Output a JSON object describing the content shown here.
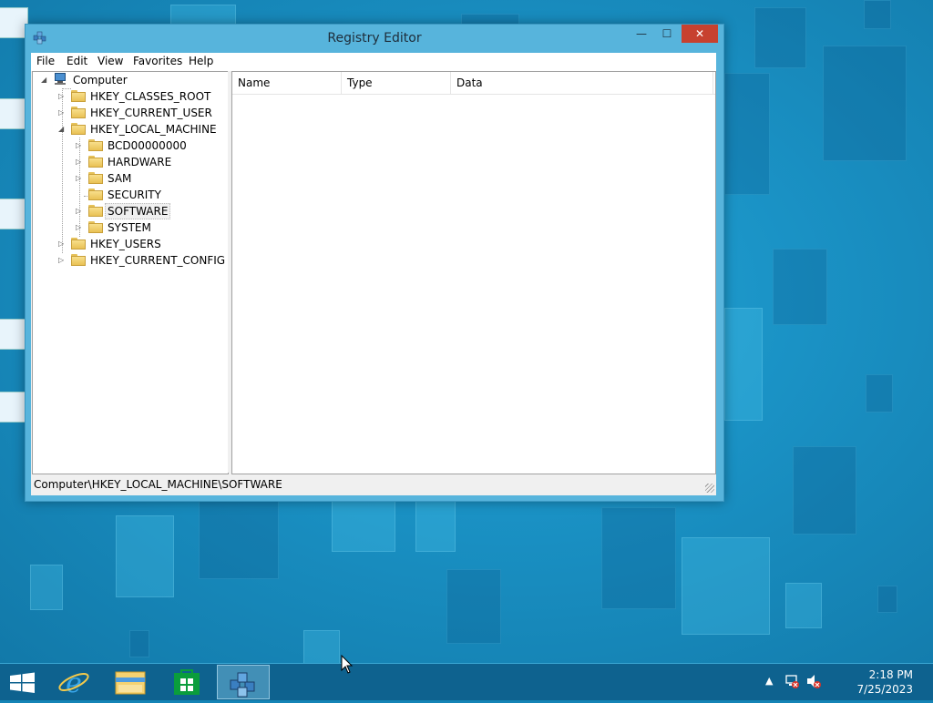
{
  "window": {
    "title": "Registry Editor",
    "buttons": {
      "minimize": "—",
      "maximize": "☐",
      "close": "✕"
    }
  },
  "menu": [
    "File",
    "Edit",
    "View",
    "Favorites",
    "Help"
  ],
  "tree": {
    "root": "Computer",
    "hives": [
      {
        "label": "HKEY_CLASSES_ROOT",
        "expand": "▷"
      },
      {
        "label": "HKEY_CURRENT_USER",
        "expand": "▷"
      },
      {
        "label": "HKEY_LOCAL_MACHINE",
        "expand": "◢"
      },
      {
        "label": "HKEY_USERS",
        "expand": "▷"
      },
      {
        "label": "HKEY_CURRENT_CONFIG",
        "expand": "▷"
      }
    ],
    "hklm_children": [
      {
        "label": "BCD00000000",
        "expand": "▷"
      },
      {
        "label": "HARDWARE",
        "expand": "▷"
      },
      {
        "label": "SAM",
        "expand": "▷"
      },
      {
        "label": "SECURITY",
        "expand": ""
      },
      {
        "label": "SOFTWARE",
        "expand": "▷",
        "selected": true
      },
      {
        "label": "SYSTEM",
        "expand": "▷"
      }
    ]
  },
  "list": {
    "columns": [
      "Name",
      "Type",
      "Data"
    ]
  },
  "status": {
    "path": "Computer\\HKEY_LOCAL_MACHINE\\SOFTWARE"
  },
  "taskbar": {
    "apps": [
      "start-button",
      "internet-explorer",
      "file-explorer",
      "store",
      "registry-editor"
    ],
    "time": "2:18 PM",
    "date": "7/25/2023"
  },
  "colors": {
    "accent": "#1a92c5",
    "close": "#c7412f"
  }
}
